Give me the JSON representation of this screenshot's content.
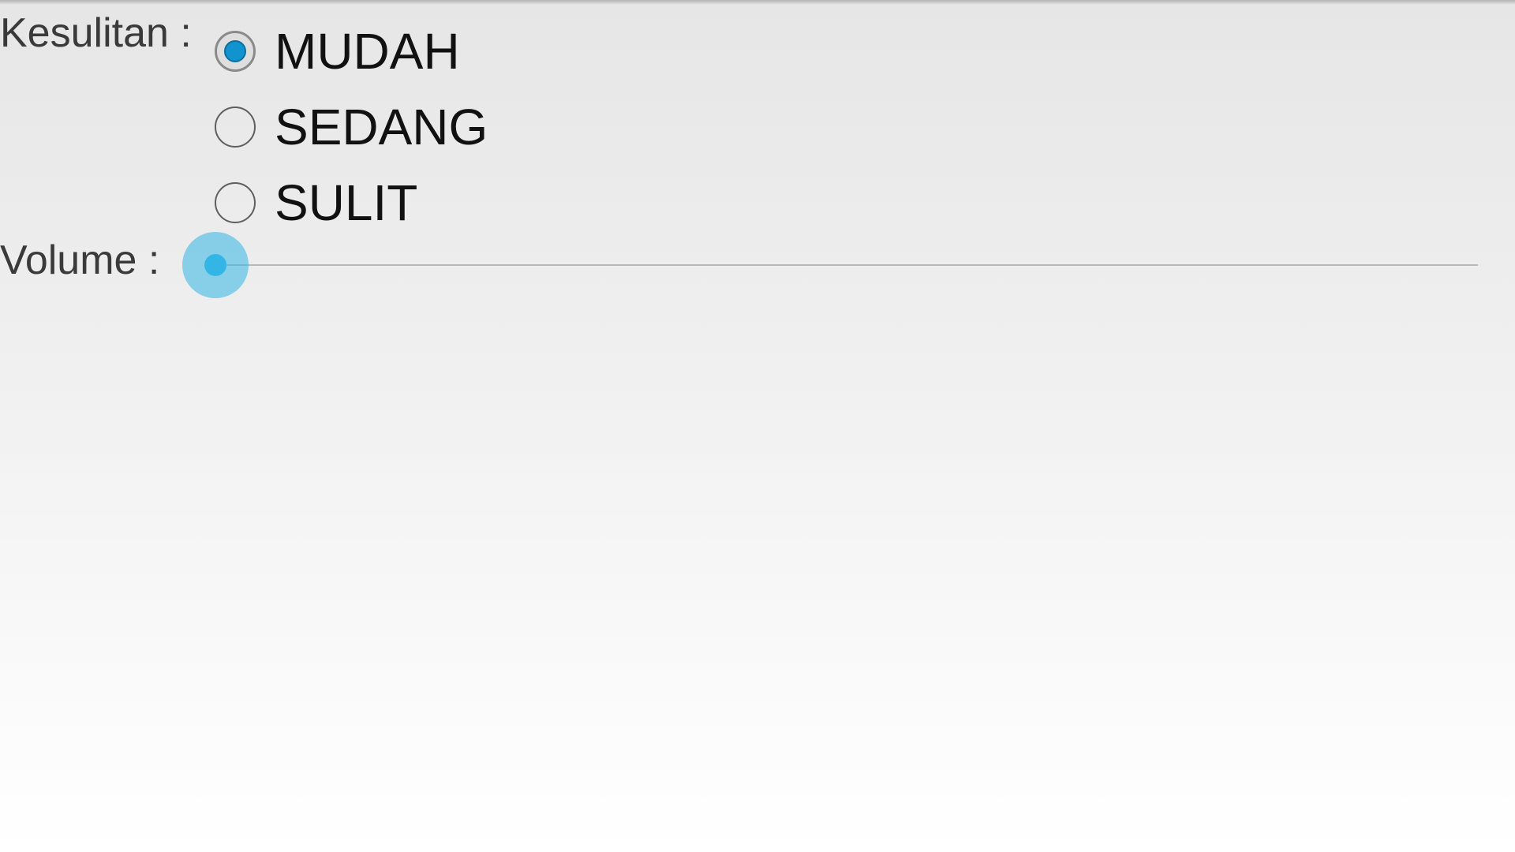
{
  "settings": {
    "difficulty": {
      "label": "Kesulitan :",
      "options": [
        {
          "label": "MUDAH",
          "selected": true
        },
        {
          "label": "SEDANG",
          "selected": false
        },
        {
          "label": "SULIT",
          "selected": false
        }
      ]
    },
    "volume": {
      "label": "Volume :",
      "value": 0,
      "max": 100
    }
  },
  "colors": {
    "accent": "#33b5e5",
    "radio_selected": "#1193cf"
  }
}
